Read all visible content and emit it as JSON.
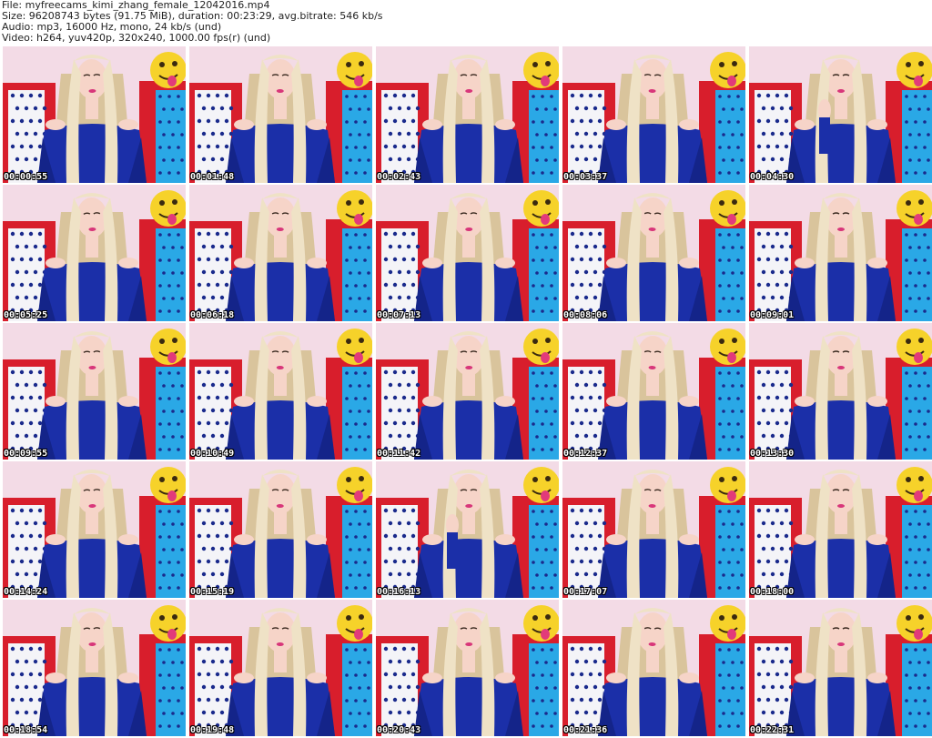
{
  "header": {
    "file_line": "File: myfreecams_kimi_zhang_female_12042016.mp4",
    "size_line": "Size: 96208743 bytes (91.75 MiB), duration: 00:23:29, avg.bitrate: 546 kb/s",
    "audio_line": "Audio: mp3, 16000 Hz, mono, 24 kb/s (und)",
    "video_line": "Video: h264, yuv420p, 320x240, 1000.00 fps(r) (und)"
  },
  "grid": {
    "columns": 5,
    "rows": 5
  },
  "thumbnails": [
    {
      "timestamp": "00:00:55"
    },
    {
      "timestamp": "00:01:48"
    },
    {
      "timestamp": "00:02:43"
    },
    {
      "timestamp": "00:03:37"
    },
    {
      "timestamp": "00:04:30"
    },
    {
      "timestamp": "00:05:25"
    },
    {
      "timestamp": "00:06:18"
    },
    {
      "timestamp": "00:07:13"
    },
    {
      "timestamp": "00:08:06"
    },
    {
      "timestamp": "00:09:01"
    },
    {
      "timestamp": "00:09:55"
    },
    {
      "timestamp": "00:10:49"
    },
    {
      "timestamp": "00:11:42"
    },
    {
      "timestamp": "00:12:37"
    },
    {
      "timestamp": "00:13:30"
    },
    {
      "timestamp": "00:14:24"
    },
    {
      "timestamp": "00:15:19"
    },
    {
      "timestamp": "00:16:13"
    },
    {
      "timestamp": "00:17:07"
    },
    {
      "timestamp": "00:18:00"
    },
    {
      "timestamp": "00:18:54"
    },
    {
      "timestamp": "00:19:48"
    },
    {
      "timestamp": "00:20:43"
    },
    {
      "timestamp": "00:21:36"
    },
    {
      "timestamp": "00:22:31"
    }
  ],
  "colors": {
    "background_wall": "#f3dbe6",
    "hair": "#efe2c6",
    "hair_shade": "#d9c49c",
    "skin": "#f6d4c8",
    "dress": "#1b2fa8",
    "dress_shade": "#142489",
    "chair_red": "#d81e2c",
    "chair_white": "#f4f4f8",
    "dots": "#1a2a8c",
    "cyan_pillow": "#2aa8e6",
    "emoji_yellow": "#f6d22a",
    "tongue": "#e23a7a",
    "lips": "#d8367a",
    "timestamp_text": "#ffffff"
  }
}
